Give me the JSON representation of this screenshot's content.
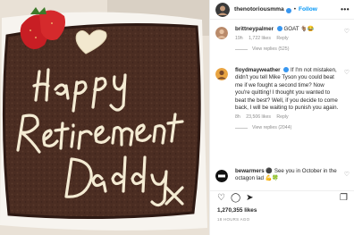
{
  "post": {
    "username": "thenotoriousmma",
    "follow_label": "Follow",
    "more_label": "•••",
    "image_alt": "Brownie cake with white icing reading Happy Retirement Daddy",
    "cake_text": [
      "Happy",
      "Retirement",
      "Daddy",
      "x"
    ]
  },
  "comments": [
    {
      "username": "brittneypalmer",
      "text": "GOAT 🐐😂",
      "time": "19h",
      "likes": "1,722 likes",
      "reply_label": "Reply",
      "view_replies": "View replies (525)"
    },
    {
      "username": "floydmayweather",
      "text": "If I'm not mistaken, didn't you tell Mike Tyson you could beat me if we fought a second time? Now you're quitting! I thought you wanted to beat the best? Well, if you decide to come back, I will be waiting to punish you again.",
      "time": "8h",
      "likes": "23,506 likes",
      "reply_label": "Reply",
      "view_replies": "View replies (2044)"
    },
    {
      "username": "bewarmers",
      "text": "⚫ See you in October in the octagon lad 💪🍀"
    }
  ],
  "actions": {
    "like": "♡",
    "comment": "◯",
    "share": "➤",
    "save": "❐"
  },
  "likes_count": "1,270,355 likes",
  "time_ago": "18 HOURS AGO",
  "colors": {
    "link_blue": "#0095f6",
    "verified_blue": "#3897f0",
    "meta_gray": "#8e8e8e",
    "brownie": "#4a2c22",
    "icing": "#f5ecd2"
  }
}
